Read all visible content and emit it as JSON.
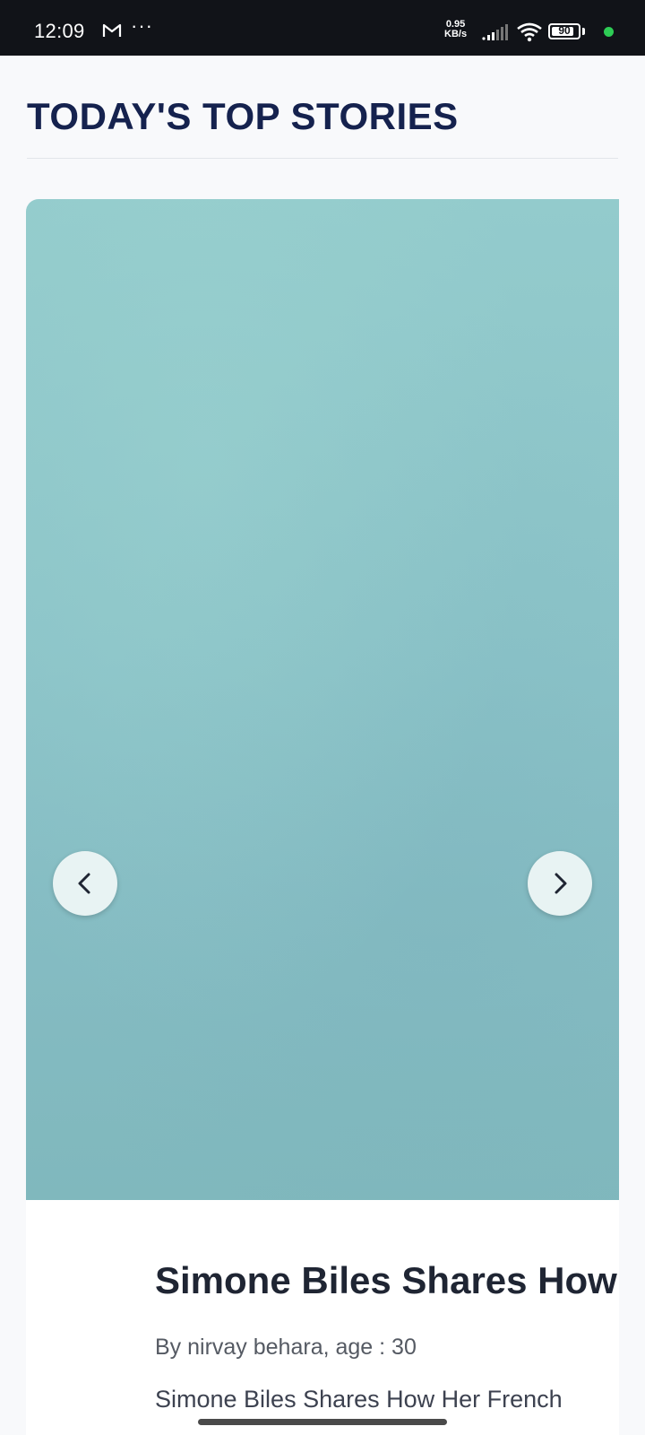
{
  "status_bar": {
    "time": "12:09",
    "more": "···",
    "net_speed_value": "0.95",
    "net_speed_unit": "KB/s",
    "battery": "90"
  },
  "page": {
    "section_title": "TODAY'S TOP STORIES"
  },
  "story": {
    "title": "Simone Biles Shares How Her French",
    "byline": "By nirvay behara, age : 30",
    "summary": "Simone Biles Shares How Her French"
  },
  "colors": {
    "title": "#15224e",
    "image_tint": "#8bc3c8",
    "status_bar": "#111318"
  }
}
